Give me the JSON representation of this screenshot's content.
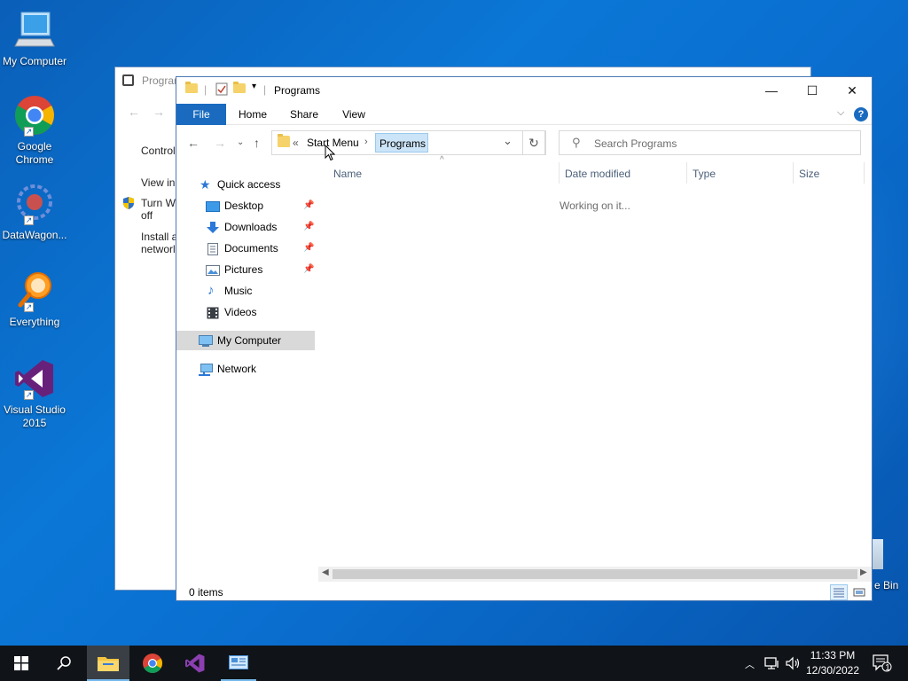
{
  "colors": {
    "desktop": "#0b77d6",
    "ribbon_file_tab": "#1a6bbf",
    "selection": "#cce4f7",
    "taskbar": "#101317"
  },
  "desktop_icons": [
    {
      "label": "My Computer",
      "icon": "computer-icon"
    },
    {
      "label": "Google Chrome",
      "icon": "chrome-icon"
    },
    {
      "label": "DataWagon...",
      "icon": "datawagon-icon"
    },
    {
      "label": "Everything",
      "icon": "everything-icon"
    },
    {
      "label": "Visual Studio 2015",
      "icon": "visual-studio-icon"
    }
  ],
  "recycle_bin_label": "e Bin",
  "background_window": {
    "title": "Prograr",
    "items": [
      "Control",
      "View in",
      "Turn W off",
      "Install a networl"
    ]
  },
  "window": {
    "title": "Programs",
    "ribbon_tabs": [
      "File",
      "Home",
      "Share",
      "View"
    ],
    "address": {
      "overflow": "«",
      "crumbs": [
        "Start Menu",
        "Programs"
      ]
    },
    "search_placeholder": "Search Programs",
    "nav": {
      "quick_access": "Quick access",
      "items": [
        "Desktop",
        "Downloads",
        "Documents",
        "Pictures",
        "Music",
        "Videos"
      ],
      "my_computer": "My Computer",
      "network": "Network"
    },
    "columns": [
      "Name",
      "Date modified",
      "Type",
      "Size"
    ],
    "working_text": "Working on it...",
    "status_text": "0 items"
  },
  "taskbar": {
    "time": "11:33 PM",
    "date": "12/30/2022",
    "notification_count": "1"
  }
}
